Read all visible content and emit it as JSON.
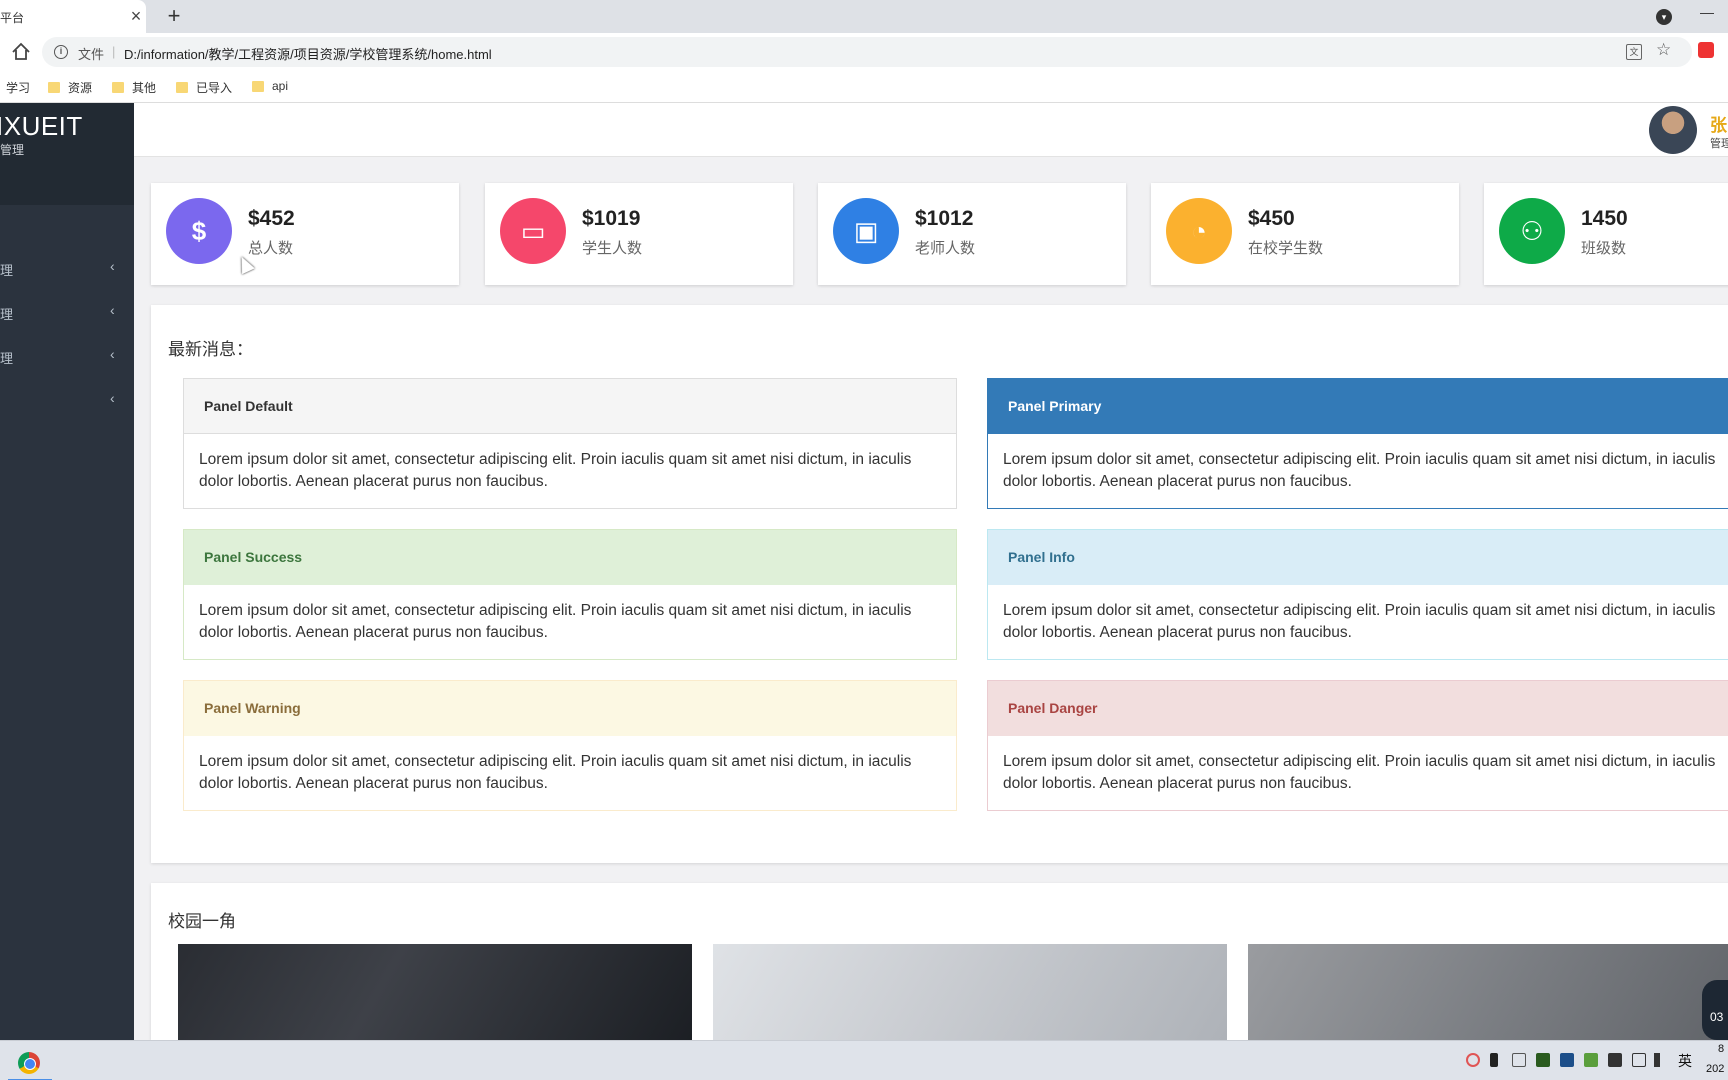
{
  "browser": {
    "tab_title": "平台",
    "close_glyph": "×",
    "new_tab_glyph": "+",
    "url_scheme_label": "文件",
    "url": "D:/information/教学/工程资源/项目资源/学校管理系统/home.html",
    "bookmarks": [
      {
        "label": "学习",
        "icon": "none"
      },
      {
        "label": "资源",
        "icon": "folder-icon"
      },
      {
        "label": "其他",
        "icon": "folder-icon"
      },
      {
        "label": "已导入",
        "icon": "folder-icon"
      },
      {
        "label": "api",
        "icon": "folder-icon"
      }
    ]
  },
  "sidebar": {
    "brand": "IXUEIT",
    "subtitle": "管理",
    "items": [
      {
        "label": "理"
      },
      {
        "label": "理"
      },
      {
        "label": "理"
      },
      {
        "label": ""
      }
    ],
    "chevron": "‹"
  },
  "header": {
    "user_name": "张",
    "user_role": "管理"
  },
  "stats": [
    {
      "value": "$452",
      "label": "总人数",
      "icon": "dollar-icon",
      "glyph": "$",
      "color": "#7b68ee"
    },
    {
      "value": "$1019",
      "label": "学生人数",
      "icon": "laptop-icon",
      "glyph": "▭",
      "color": "#f5476b"
    },
    {
      "value": "$1012",
      "label": "老师人数",
      "icon": "money-icon",
      "glyph": "▣",
      "color": "#2f80e4"
    },
    {
      "value": "$450",
      "label": "在校学生数",
      "icon": "pie-chart-icon",
      "glyph": "◔",
      "color": "#fbb12f"
    },
    {
      "value": "1450",
      "label": "班级数",
      "icon": "users-icon",
      "glyph": "⚇",
      "color": "#0eaa48"
    }
  ],
  "news": {
    "title": "最新消息：",
    "panels": [
      {
        "heading": "Panel Default",
        "body": "Lorem ipsum dolor sit amet, consectetur adipiscing elit. Proin iaculis quam sit amet nisi dictum, in iaculis dolor lobortis. Aenean placerat purus non faucibus."
      },
      {
        "heading": "Panel Primary",
        "body": "Lorem ipsum dolor sit amet, consectetur adipiscing elit. Proin iaculis quam sit amet nisi dictum, in iaculis dolor lobortis. Aenean placerat purus non faucibus."
      },
      {
        "heading": "Panel Success",
        "body": "Lorem ipsum dolor sit amet, consectetur adipiscing elit. Proin iaculis quam sit amet nisi dictum, in iaculis dolor lobortis. Aenean placerat purus non faucibus."
      },
      {
        "heading": "Panel Info",
        "body": "Lorem ipsum dolor sit amet, consectetur adipiscing elit. Proin iaculis quam sit amet nisi dictum, in iaculis dolor lobortis. Aenean placerat purus non faucibus."
      },
      {
        "heading": "Panel Warning",
        "body": "Lorem ipsum dolor sit amet, consectetur adipiscing elit. Proin iaculis quam sit amet nisi dictum, in iaculis dolor lobortis. Aenean placerat purus non faucibus."
      },
      {
        "heading": "Panel Danger",
        "body": "Lorem ipsum dolor sit amet, consectetur adipiscing elit. Proin iaculis quam sit amet nisi dictum, in iaculis dolor lobortis. Aenean placerat purus non faucibus."
      }
    ]
  },
  "gallery": {
    "title": "校园一角"
  },
  "taskbar": {
    "ime": "英",
    "clock_line1": "8",
    "clock_line2": "202",
    "widget_text": "03"
  }
}
